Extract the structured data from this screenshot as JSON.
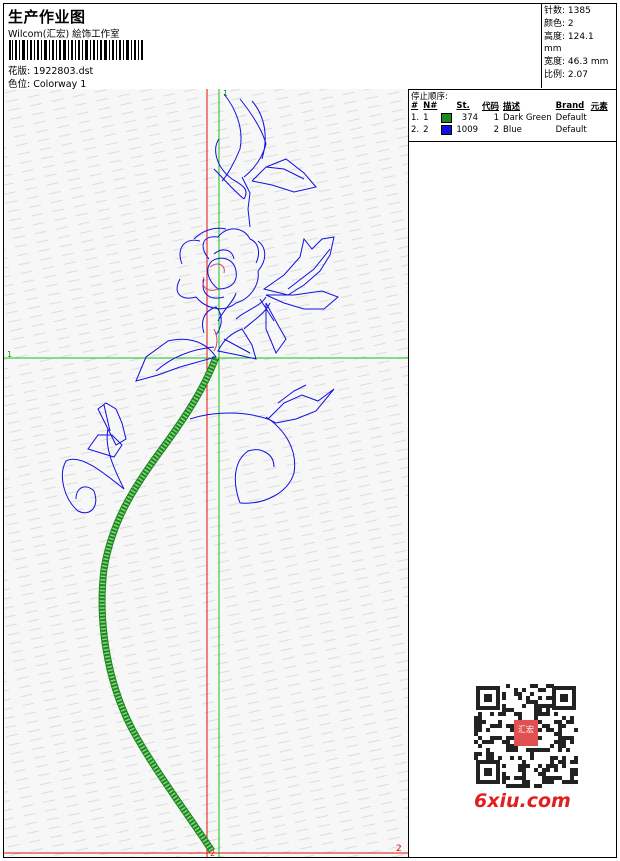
{
  "header": {
    "title": "生产作业图",
    "company": "Wilcom(汇宏) 絵饰工作室",
    "design_label": "花版:",
    "design_file": "1922803.dst",
    "colorway_label": "色位:",
    "colorway_value": "Colorway 1"
  },
  "stats": {
    "stitches_label": "针数:",
    "stitches": "1385",
    "colors_label": "颜色:",
    "colors": "2",
    "height_label": "高度:",
    "height": "124.1 mm",
    "width_label": "宽度:",
    "width": "46.3 mm",
    "scale_label": "比例:",
    "scale": "2.07"
  },
  "stop_sequence": {
    "title": "停止顺序:",
    "columns": [
      "#",
      "N#",
      "St.",
      "代码",
      "描述",
      "Brand",
      "元素"
    ],
    "rows": [
      {
        "index": "1.",
        "needle": "1",
        "color": "#1a8a1a",
        "stitches": "374",
        "code": "1",
        "description": "Dark Green",
        "brand": "Default",
        "element": ""
      },
      {
        "index": "2.",
        "needle": "2",
        "color": "#1010e0",
        "stitches": "1009",
        "code": "2",
        "description": "Blue",
        "brand": "Default",
        "element": ""
      }
    ]
  },
  "guides": {
    "top_label": "1",
    "left_label": "1",
    "right_label": "2",
    "bottom_label": "2"
  },
  "watermark": {
    "qr_center_text": "汇宏",
    "site": "6xiu.com"
  },
  "colors": {
    "stem_green": "#1a8a1a",
    "outline_blue": "#1010e0",
    "guide_red": "#e01010",
    "guide_green": "#10c010",
    "flower_pink": "#d04080",
    "brand_red": "#e02020"
  }
}
